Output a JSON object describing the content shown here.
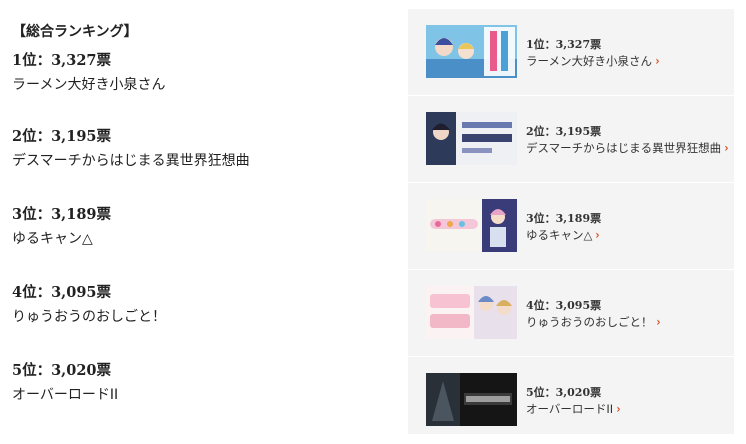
{
  "article": {
    "heading": "【総合ランキング】",
    "entries": [
      {
        "rank": "1位：3,327票",
        "title": "ラーメン大好き小泉さん"
      },
      {
        "rank": "2位：3,195票",
        "title": "デスマーチからはじまる異世界狂想曲"
      },
      {
        "rank": "3位：3,189票",
        "title": "ゆるキャン△"
      },
      {
        "rank": "4位：3,095票",
        "title": "りゅうおうのおしごと！"
      },
      {
        "rank": "5位：3,020票",
        "title": "オーバーロードII"
      }
    ]
  },
  "card": {
    "items": [
      {
        "rank": "1位：3,327票",
        "title": "ラーメン大好き小泉さん",
        "chevron": "›",
        "thumb_icon": "anime-key-visual-1"
      },
      {
        "rank": "2位：3,195票",
        "title": "デスマーチからはじまる異世界狂想曲",
        "chevron": "›",
        "thumb_icon": "anime-key-visual-2"
      },
      {
        "rank": "3位：3,189票",
        "title": "ゆるキャン△",
        "chevron": "›",
        "thumb_icon": "anime-key-visual-3"
      },
      {
        "rank": "4位：3,095票",
        "title": "りゅうおうのおしごと！",
        "chevron": "›",
        "thumb_icon": "anime-key-visual-4"
      },
      {
        "rank": "5位：3,020票",
        "title": "オーバーロードII",
        "chevron": "›",
        "thumb_icon": "anime-key-visual-5"
      }
    ]
  },
  "colors": {
    "card_bg": "#f4f4f4",
    "chevron": "#d24a1c",
    "text": "#222222"
  }
}
